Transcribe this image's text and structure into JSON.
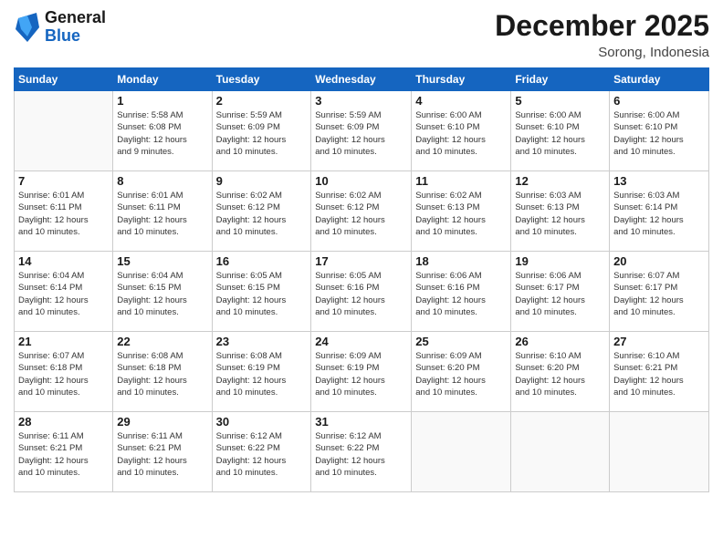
{
  "logo": {
    "line1": "General",
    "line2": "Blue"
  },
  "title": "December 2025",
  "subtitle": "Sorong, Indonesia",
  "weekdays": [
    "Sunday",
    "Monday",
    "Tuesday",
    "Wednesday",
    "Thursday",
    "Friday",
    "Saturday"
  ],
  "weeks": [
    [
      {
        "day": "",
        "info": ""
      },
      {
        "day": "1",
        "info": "Sunrise: 5:58 AM\nSunset: 6:08 PM\nDaylight: 12 hours\nand 9 minutes."
      },
      {
        "day": "2",
        "info": "Sunrise: 5:59 AM\nSunset: 6:09 PM\nDaylight: 12 hours\nand 10 minutes."
      },
      {
        "day": "3",
        "info": "Sunrise: 5:59 AM\nSunset: 6:09 PM\nDaylight: 12 hours\nand 10 minutes."
      },
      {
        "day": "4",
        "info": "Sunrise: 6:00 AM\nSunset: 6:10 PM\nDaylight: 12 hours\nand 10 minutes."
      },
      {
        "day": "5",
        "info": "Sunrise: 6:00 AM\nSunset: 6:10 PM\nDaylight: 12 hours\nand 10 minutes."
      },
      {
        "day": "6",
        "info": "Sunrise: 6:00 AM\nSunset: 6:10 PM\nDaylight: 12 hours\nand 10 minutes."
      }
    ],
    [
      {
        "day": "7",
        "info": "Sunrise: 6:01 AM\nSunset: 6:11 PM\nDaylight: 12 hours\nand 10 minutes."
      },
      {
        "day": "8",
        "info": "Sunrise: 6:01 AM\nSunset: 6:11 PM\nDaylight: 12 hours\nand 10 minutes."
      },
      {
        "day": "9",
        "info": "Sunrise: 6:02 AM\nSunset: 6:12 PM\nDaylight: 12 hours\nand 10 minutes."
      },
      {
        "day": "10",
        "info": "Sunrise: 6:02 AM\nSunset: 6:12 PM\nDaylight: 12 hours\nand 10 minutes."
      },
      {
        "day": "11",
        "info": "Sunrise: 6:02 AM\nSunset: 6:13 PM\nDaylight: 12 hours\nand 10 minutes."
      },
      {
        "day": "12",
        "info": "Sunrise: 6:03 AM\nSunset: 6:13 PM\nDaylight: 12 hours\nand 10 minutes."
      },
      {
        "day": "13",
        "info": "Sunrise: 6:03 AM\nSunset: 6:14 PM\nDaylight: 12 hours\nand 10 minutes."
      }
    ],
    [
      {
        "day": "14",
        "info": "Sunrise: 6:04 AM\nSunset: 6:14 PM\nDaylight: 12 hours\nand 10 minutes."
      },
      {
        "day": "15",
        "info": "Sunrise: 6:04 AM\nSunset: 6:15 PM\nDaylight: 12 hours\nand 10 minutes."
      },
      {
        "day": "16",
        "info": "Sunrise: 6:05 AM\nSunset: 6:15 PM\nDaylight: 12 hours\nand 10 minutes."
      },
      {
        "day": "17",
        "info": "Sunrise: 6:05 AM\nSunset: 6:16 PM\nDaylight: 12 hours\nand 10 minutes."
      },
      {
        "day": "18",
        "info": "Sunrise: 6:06 AM\nSunset: 6:16 PM\nDaylight: 12 hours\nand 10 minutes."
      },
      {
        "day": "19",
        "info": "Sunrise: 6:06 AM\nSunset: 6:17 PM\nDaylight: 12 hours\nand 10 minutes."
      },
      {
        "day": "20",
        "info": "Sunrise: 6:07 AM\nSunset: 6:17 PM\nDaylight: 12 hours\nand 10 minutes."
      }
    ],
    [
      {
        "day": "21",
        "info": "Sunrise: 6:07 AM\nSunset: 6:18 PM\nDaylight: 12 hours\nand 10 minutes."
      },
      {
        "day": "22",
        "info": "Sunrise: 6:08 AM\nSunset: 6:18 PM\nDaylight: 12 hours\nand 10 minutes."
      },
      {
        "day": "23",
        "info": "Sunrise: 6:08 AM\nSunset: 6:19 PM\nDaylight: 12 hours\nand 10 minutes."
      },
      {
        "day": "24",
        "info": "Sunrise: 6:09 AM\nSunset: 6:19 PM\nDaylight: 12 hours\nand 10 minutes."
      },
      {
        "day": "25",
        "info": "Sunrise: 6:09 AM\nSunset: 6:20 PM\nDaylight: 12 hours\nand 10 minutes."
      },
      {
        "day": "26",
        "info": "Sunrise: 6:10 AM\nSunset: 6:20 PM\nDaylight: 12 hours\nand 10 minutes."
      },
      {
        "day": "27",
        "info": "Sunrise: 6:10 AM\nSunset: 6:21 PM\nDaylight: 12 hours\nand 10 minutes."
      }
    ],
    [
      {
        "day": "28",
        "info": "Sunrise: 6:11 AM\nSunset: 6:21 PM\nDaylight: 12 hours\nand 10 minutes."
      },
      {
        "day": "29",
        "info": "Sunrise: 6:11 AM\nSunset: 6:21 PM\nDaylight: 12 hours\nand 10 minutes."
      },
      {
        "day": "30",
        "info": "Sunrise: 6:12 AM\nSunset: 6:22 PM\nDaylight: 12 hours\nand 10 minutes."
      },
      {
        "day": "31",
        "info": "Sunrise: 6:12 AM\nSunset: 6:22 PM\nDaylight: 12 hours\nand 10 minutes."
      },
      {
        "day": "",
        "info": ""
      },
      {
        "day": "",
        "info": ""
      },
      {
        "day": "",
        "info": ""
      }
    ]
  ]
}
